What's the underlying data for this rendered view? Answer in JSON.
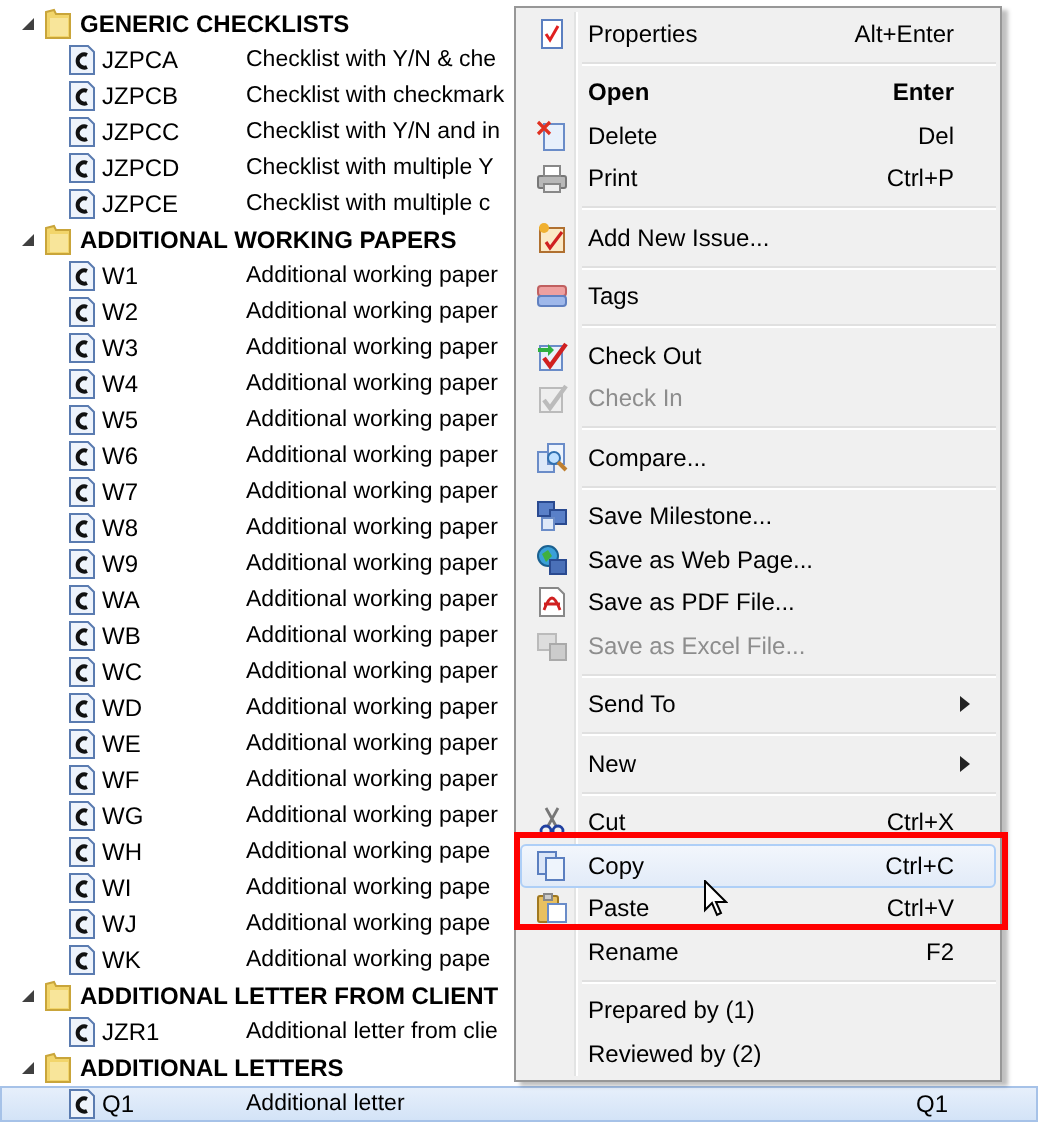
{
  "tree": {
    "groups": [
      {
        "label": "GENERIC CHECKLISTS",
        "expanded": true,
        "children": [
          {
            "code": "JZPCA",
            "description": "Checklist with Y/N & che",
            "selected": false
          },
          {
            "code": "JZPCB",
            "description": "Checklist with checkmark",
            "selected": false
          },
          {
            "code": "JZPCC",
            "description": "Checklist with Y/N and in",
            "selected": false
          },
          {
            "code": "JZPCD",
            "description": "Checklist with multiple Y",
            "selected": false
          },
          {
            "code": "JZPCE",
            "description": "Checklist with multiple c",
            "selected": false
          }
        ]
      },
      {
        "label": "ADDITIONAL WORKING PAPERS",
        "expanded": true,
        "children": [
          {
            "code": "W1",
            "description": "Additional working paper",
            "selected": false
          },
          {
            "code": "W2",
            "description": "Additional working paper",
            "selected": false
          },
          {
            "code": "W3",
            "description": "Additional working paper",
            "selected": false
          },
          {
            "code": "W4",
            "description": "Additional working paper",
            "selected": false
          },
          {
            "code": "W5",
            "description": "Additional working paper",
            "selected": false
          },
          {
            "code": "W6",
            "description": "Additional working paper",
            "selected": false
          },
          {
            "code": "W7",
            "description": "Additional working paper",
            "selected": false
          },
          {
            "code": "W8",
            "description": "Additional working paper",
            "selected": false
          },
          {
            "code": "W9",
            "description": "Additional working paper",
            "selected": false
          },
          {
            "code": "WA",
            "description": "Additional working paper",
            "selected": false
          },
          {
            "code": "WB",
            "description": "Additional working paper",
            "selected": false
          },
          {
            "code": "WC",
            "description": "Additional working paper",
            "selected": false
          },
          {
            "code": "WD",
            "description": "Additional working paper",
            "selected": false
          },
          {
            "code": "WE",
            "description": "Additional working paper",
            "selected": false
          },
          {
            "code": "WF",
            "description": "Additional working paper",
            "selected": false
          },
          {
            "code": "WG",
            "description": "Additional working paper",
            "selected": false
          },
          {
            "code": "WH",
            "description": "Additional working pape",
            "selected": false
          },
          {
            "code": "WI",
            "description": "Additional working pape",
            "selected": false
          },
          {
            "code": "WJ",
            "description": "Additional working pape",
            "selected": false
          },
          {
            "code": "WK",
            "description": "Additional working pape",
            "selected": false
          }
        ]
      },
      {
        "label": "ADDITIONAL LETTER FROM CLIENT",
        "expanded": true,
        "children": [
          {
            "code": "JZR1",
            "description": "Additional letter from clie",
            "selected": false
          }
        ]
      },
      {
        "label": "ADDITIONAL LETTERS",
        "expanded": true,
        "children": [
          {
            "code": "Q1",
            "description": "Additional letter",
            "column_3": "Q1",
            "selected": true
          }
        ]
      }
    ]
  },
  "context_menu": {
    "items": [
      {
        "kind": "item",
        "label": "Properties",
        "shortcut": "Alt+Enter",
        "bold": false,
        "disabled": false,
        "selected": false
      },
      {
        "kind": "separator"
      },
      {
        "kind": "item",
        "label": "Open",
        "shortcut": "Enter",
        "bold": true,
        "disabled": false,
        "selected": false
      },
      {
        "kind": "item",
        "label": "Delete",
        "shortcut": "Del",
        "bold": false,
        "disabled": false,
        "selected": false
      },
      {
        "kind": "item",
        "label": "Print",
        "shortcut": "Ctrl+P",
        "bold": false,
        "disabled": false,
        "selected": false
      },
      {
        "kind": "separator"
      },
      {
        "kind": "item",
        "label": "Add New Issue...",
        "bold": false,
        "disabled": false,
        "selected": false
      },
      {
        "kind": "separator"
      },
      {
        "kind": "item",
        "label": "Tags",
        "bold": false,
        "disabled": false,
        "selected": false
      },
      {
        "kind": "separator"
      },
      {
        "kind": "item",
        "label": "Check Out",
        "bold": false,
        "disabled": false,
        "selected": false
      },
      {
        "kind": "item",
        "label": "Check In",
        "bold": false,
        "disabled": true,
        "selected": false
      },
      {
        "kind": "separator"
      },
      {
        "kind": "item",
        "label": "Compare...",
        "bold": false,
        "disabled": false,
        "selected": false
      },
      {
        "kind": "separator"
      },
      {
        "kind": "item",
        "label": "Save Milestone...",
        "bold": false,
        "disabled": false,
        "selected": false
      },
      {
        "kind": "item",
        "label": "Save as Web Page...",
        "bold": false,
        "disabled": false,
        "selected": false
      },
      {
        "kind": "item",
        "label": "Save as PDF File...",
        "bold": false,
        "disabled": false,
        "selected": false
      },
      {
        "kind": "item",
        "label": "Save as Excel File...",
        "bold": false,
        "disabled": true,
        "selected": false
      },
      {
        "kind": "separator"
      },
      {
        "kind": "submenu",
        "label": "Send To",
        "bold": false,
        "disabled": false,
        "selected": false
      },
      {
        "kind": "separator"
      },
      {
        "kind": "submenu",
        "label": "New",
        "bold": false,
        "disabled": false,
        "selected": false
      },
      {
        "kind": "separator"
      },
      {
        "kind": "item",
        "label": "Cut",
        "shortcut": "Ctrl+X",
        "bold": false,
        "disabled": false,
        "selected": false
      },
      {
        "kind": "item",
        "label": "Copy",
        "shortcut": "Ctrl+C",
        "bold": false,
        "disabled": false,
        "selected": true
      },
      {
        "kind": "item",
        "label": "Paste",
        "shortcut": "Ctrl+V",
        "bold": false,
        "disabled": false,
        "selected": false
      },
      {
        "kind": "item",
        "label": "Rename",
        "shortcut": "F2",
        "bold": false,
        "disabled": false,
        "selected": false
      },
      {
        "kind": "separator"
      },
      {
        "kind": "item",
        "label": "Prepared by (1)",
        "bold": false,
        "disabled": false,
        "selected": false
      },
      {
        "kind": "item",
        "label": "Reviewed by (2)",
        "bold": false,
        "disabled": false,
        "selected": false
      }
    ]
  }
}
